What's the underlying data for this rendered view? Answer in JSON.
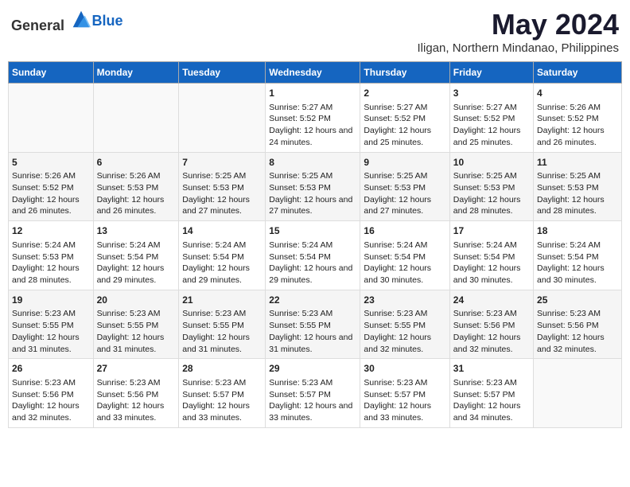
{
  "header": {
    "logo_general": "General",
    "logo_blue": "Blue",
    "title": "May 2024",
    "subtitle": "Iligan, Northern Mindanao, Philippines"
  },
  "weekdays": [
    "Sunday",
    "Monday",
    "Tuesday",
    "Wednesday",
    "Thursday",
    "Friday",
    "Saturday"
  ],
  "weeks": [
    {
      "days": [
        {
          "number": "",
          "sunrise": "",
          "sunset": "",
          "daylight": "",
          "empty": true
        },
        {
          "number": "",
          "sunrise": "",
          "sunset": "",
          "daylight": "",
          "empty": true
        },
        {
          "number": "",
          "sunrise": "",
          "sunset": "",
          "daylight": "",
          "empty": true
        },
        {
          "number": "1",
          "sunrise": "Sunrise: 5:27 AM",
          "sunset": "Sunset: 5:52 PM",
          "daylight": "Daylight: 12 hours and 24 minutes.",
          "empty": false
        },
        {
          "number": "2",
          "sunrise": "Sunrise: 5:27 AM",
          "sunset": "Sunset: 5:52 PM",
          "daylight": "Daylight: 12 hours and 25 minutes.",
          "empty": false
        },
        {
          "number": "3",
          "sunrise": "Sunrise: 5:27 AM",
          "sunset": "Sunset: 5:52 PM",
          "daylight": "Daylight: 12 hours and 25 minutes.",
          "empty": false
        },
        {
          "number": "4",
          "sunrise": "Sunrise: 5:26 AM",
          "sunset": "Sunset: 5:52 PM",
          "daylight": "Daylight: 12 hours and 26 minutes.",
          "empty": false
        }
      ]
    },
    {
      "days": [
        {
          "number": "5",
          "sunrise": "Sunrise: 5:26 AM",
          "sunset": "Sunset: 5:52 PM",
          "daylight": "Daylight: 12 hours and 26 minutes.",
          "empty": false
        },
        {
          "number": "6",
          "sunrise": "Sunrise: 5:26 AM",
          "sunset": "Sunset: 5:53 PM",
          "daylight": "Daylight: 12 hours and 26 minutes.",
          "empty": false
        },
        {
          "number": "7",
          "sunrise": "Sunrise: 5:25 AM",
          "sunset": "Sunset: 5:53 PM",
          "daylight": "Daylight: 12 hours and 27 minutes.",
          "empty": false
        },
        {
          "number": "8",
          "sunrise": "Sunrise: 5:25 AM",
          "sunset": "Sunset: 5:53 PM",
          "daylight": "Daylight: 12 hours and 27 minutes.",
          "empty": false
        },
        {
          "number": "9",
          "sunrise": "Sunrise: 5:25 AM",
          "sunset": "Sunset: 5:53 PM",
          "daylight": "Daylight: 12 hours and 27 minutes.",
          "empty": false
        },
        {
          "number": "10",
          "sunrise": "Sunrise: 5:25 AM",
          "sunset": "Sunset: 5:53 PM",
          "daylight": "Daylight: 12 hours and 28 minutes.",
          "empty": false
        },
        {
          "number": "11",
          "sunrise": "Sunrise: 5:25 AM",
          "sunset": "Sunset: 5:53 PM",
          "daylight": "Daylight: 12 hours and 28 minutes.",
          "empty": false
        }
      ]
    },
    {
      "days": [
        {
          "number": "12",
          "sunrise": "Sunrise: 5:24 AM",
          "sunset": "Sunset: 5:53 PM",
          "daylight": "Daylight: 12 hours and 28 minutes.",
          "empty": false
        },
        {
          "number": "13",
          "sunrise": "Sunrise: 5:24 AM",
          "sunset": "Sunset: 5:54 PM",
          "daylight": "Daylight: 12 hours and 29 minutes.",
          "empty": false
        },
        {
          "number": "14",
          "sunrise": "Sunrise: 5:24 AM",
          "sunset": "Sunset: 5:54 PM",
          "daylight": "Daylight: 12 hours and 29 minutes.",
          "empty": false
        },
        {
          "number": "15",
          "sunrise": "Sunrise: 5:24 AM",
          "sunset": "Sunset: 5:54 PM",
          "daylight": "Daylight: 12 hours and 29 minutes.",
          "empty": false
        },
        {
          "number": "16",
          "sunrise": "Sunrise: 5:24 AM",
          "sunset": "Sunset: 5:54 PM",
          "daylight": "Daylight: 12 hours and 30 minutes.",
          "empty": false
        },
        {
          "number": "17",
          "sunrise": "Sunrise: 5:24 AM",
          "sunset": "Sunset: 5:54 PM",
          "daylight": "Daylight: 12 hours and 30 minutes.",
          "empty": false
        },
        {
          "number": "18",
          "sunrise": "Sunrise: 5:24 AM",
          "sunset": "Sunset: 5:54 PM",
          "daylight": "Daylight: 12 hours and 30 minutes.",
          "empty": false
        }
      ]
    },
    {
      "days": [
        {
          "number": "19",
          "sunrise": "Sunrise: 5:23 AM",
          "sunset": "Sunset: 5:55 PM",
          "daylight": "Daylight: 12 hours and 31 minutes.",
          "empty": false
        },
        {
          "number": "20",
          "sunrise": "Sunrise: 5:23 AM",
          "sunset": "Sunset: 5:55 PM",
          "daylight": "Daylight: 12 hours and 31 minutes.",
          "empty": false
        },
        {
          "number": "21",
          "sunrise": "Sunrise: 5:23 AM",
          "sunset": "Sunset: 5:55 PM",
          "daylight": "Daylight: 12 hours and 31 minutes.",
          "empty": false
        },
        {
          "number": "22",
          "sunrise": "Sunrise: 5:23 AM",
          "sunset": "Sunset: 5:55 PM",
          "daylight": "Daylight: 12 hours and 31 minutes.",
          "empty": false
        },
        {
          "number": "23",
          "sunrise": "Sunrise: 5:23 AM",
          "sunset": "Sunset: 5:55 PM",
          "daylight": "Daylight: 12 hours and 32 minutes.",
          "empty": false
        },
        {
          "number": "24",
          "sunrise": "Sunrise: 5:23 AM",
          "sunset": "Sunset: 5:56 PM",
          "daylight": "Daylight: 12 hours and 32 minutes.",
          "empty": false
        },
        {
          "number": "25",
          "sunrise": "Sunrise: 5:23 AM",
          "sunset": "Sunset: 5:56 PM",
          "daylight": "Daylight: 12 hours and 32 minutes.",
          "empty": false
        }
      ]
    },
    {
      "days": [
        {
          "number": "26",
          "sunrise": "Sunrise: 5:23 AM",
          "sunset": "Sunset: 5:56 PM",
          "daylight": "Daylight: 12 hours and 32 minutes.",
          "empty": false
        },
        {
          "number": "27",
          "sunrise": "Sunrise: 5:23 AM",
          "sunset": "Sunset: 5:56 PM",
          "daylight": "Daylight: 12 hours and 33 minutes.",
          "empty": false
        },
        {
          "number": "28",
          "sunrise": "Sunrise: 5:23 AM",
          "sunset": "Sunset: 5:57 PM",
          "daylight": "Daylight: 12 hours and 33 minutes.",
          "empty": false
        },
        {
          "number": "29",
          "sunrise": "Sunrise: 5:23 AM",
          "sunset": "Sunset: 5:57 PM",
          "daylight": "Daylight: 12 hours and 33 minutes.",
          "empty": false
        },
        {
          "number": "30",
          "sunrise": "Sunrise: 5:23 AM",
          "sunset": "Sunset: 5:57 PM",
          "daylight": "Daylight: 12 hours and 33 minutes.",
          "empty": false
        },
        {
          "number": "31",
          "sunrise": "Sunrise: 5:23 AM",
          "sunset": "Sunset: 5:57 PM",
          "daylight": "Daylight: 12 hours and 34 minutes.",
          "empty": false
        },
        {
          "number": "",
          "sunrise": "",
          "sunset": "",
          "daylight": "",
          "empty": true
        }
      ]
    }
  ]
}
